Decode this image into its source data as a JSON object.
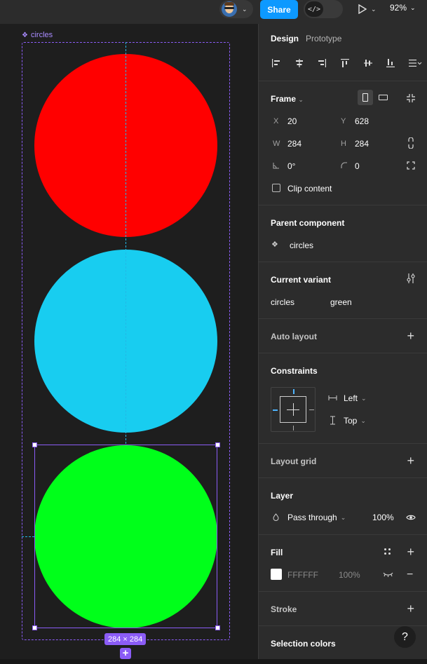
{
  "topbar": {
    "share_label": "Share",
    "dev_mode_icon": "code-icon",
    "zoom_label": "92%"
  },
  "canvas": {
    "component_name": "circles",
    "selection_size": "284 × 284",
    "circles": [
      {
        "name": "red",
        "color": "#ff0000"
      },
      {
        "name": "blue",
        "color": "#18cdf0"
      },
      {
        "name": "green",
        "color": "#00ff1a"
      }
    ]
  },
  "panel": {
    "tabs": [
      "Design",
      "Prototype"
    ],
    "frame": {
      "title": "Frame",
      "x_label": "X",
      "x": "20",
      "y_label": "Y",
      "y": "628",
      "w_label": "W",
      "w": "284",
      "h_label": "H",
      "h": "284",
      "rotation": "0°",
      "radius": "0",
      "clip_label": "Clip content"
    },
    "parent_component": {
      "title": "Parent component",
      "name": "circles"
    },
    "current_variant": {
      "title": "Current variant",
      "property": "circles",
      "value": "green"
    },
    "auto_layout": {
      "title": "Auto layout"
    },
    "constraints": {
      "title": "Constraints",
      "horizontal": "Left",
      "vertical": "Top"
    },
    "layout_grid": {
      "title": "Layout grid"
    },
    "layer": {
      "title": "Layer",
      "blend": "Pass through",
      "opacity": "100%"
    },
    "fill": {
      "title": "Fill",
      "hex": "FFFFFF",
      "opacity": "100%",
      "color": "#ffffff"
    },
    "stroke": {
      "title": "Stroke"
    },
    "selection_colors": {
      "title": "Selection colors"
    }
  },
  "help_label": "?"
}
